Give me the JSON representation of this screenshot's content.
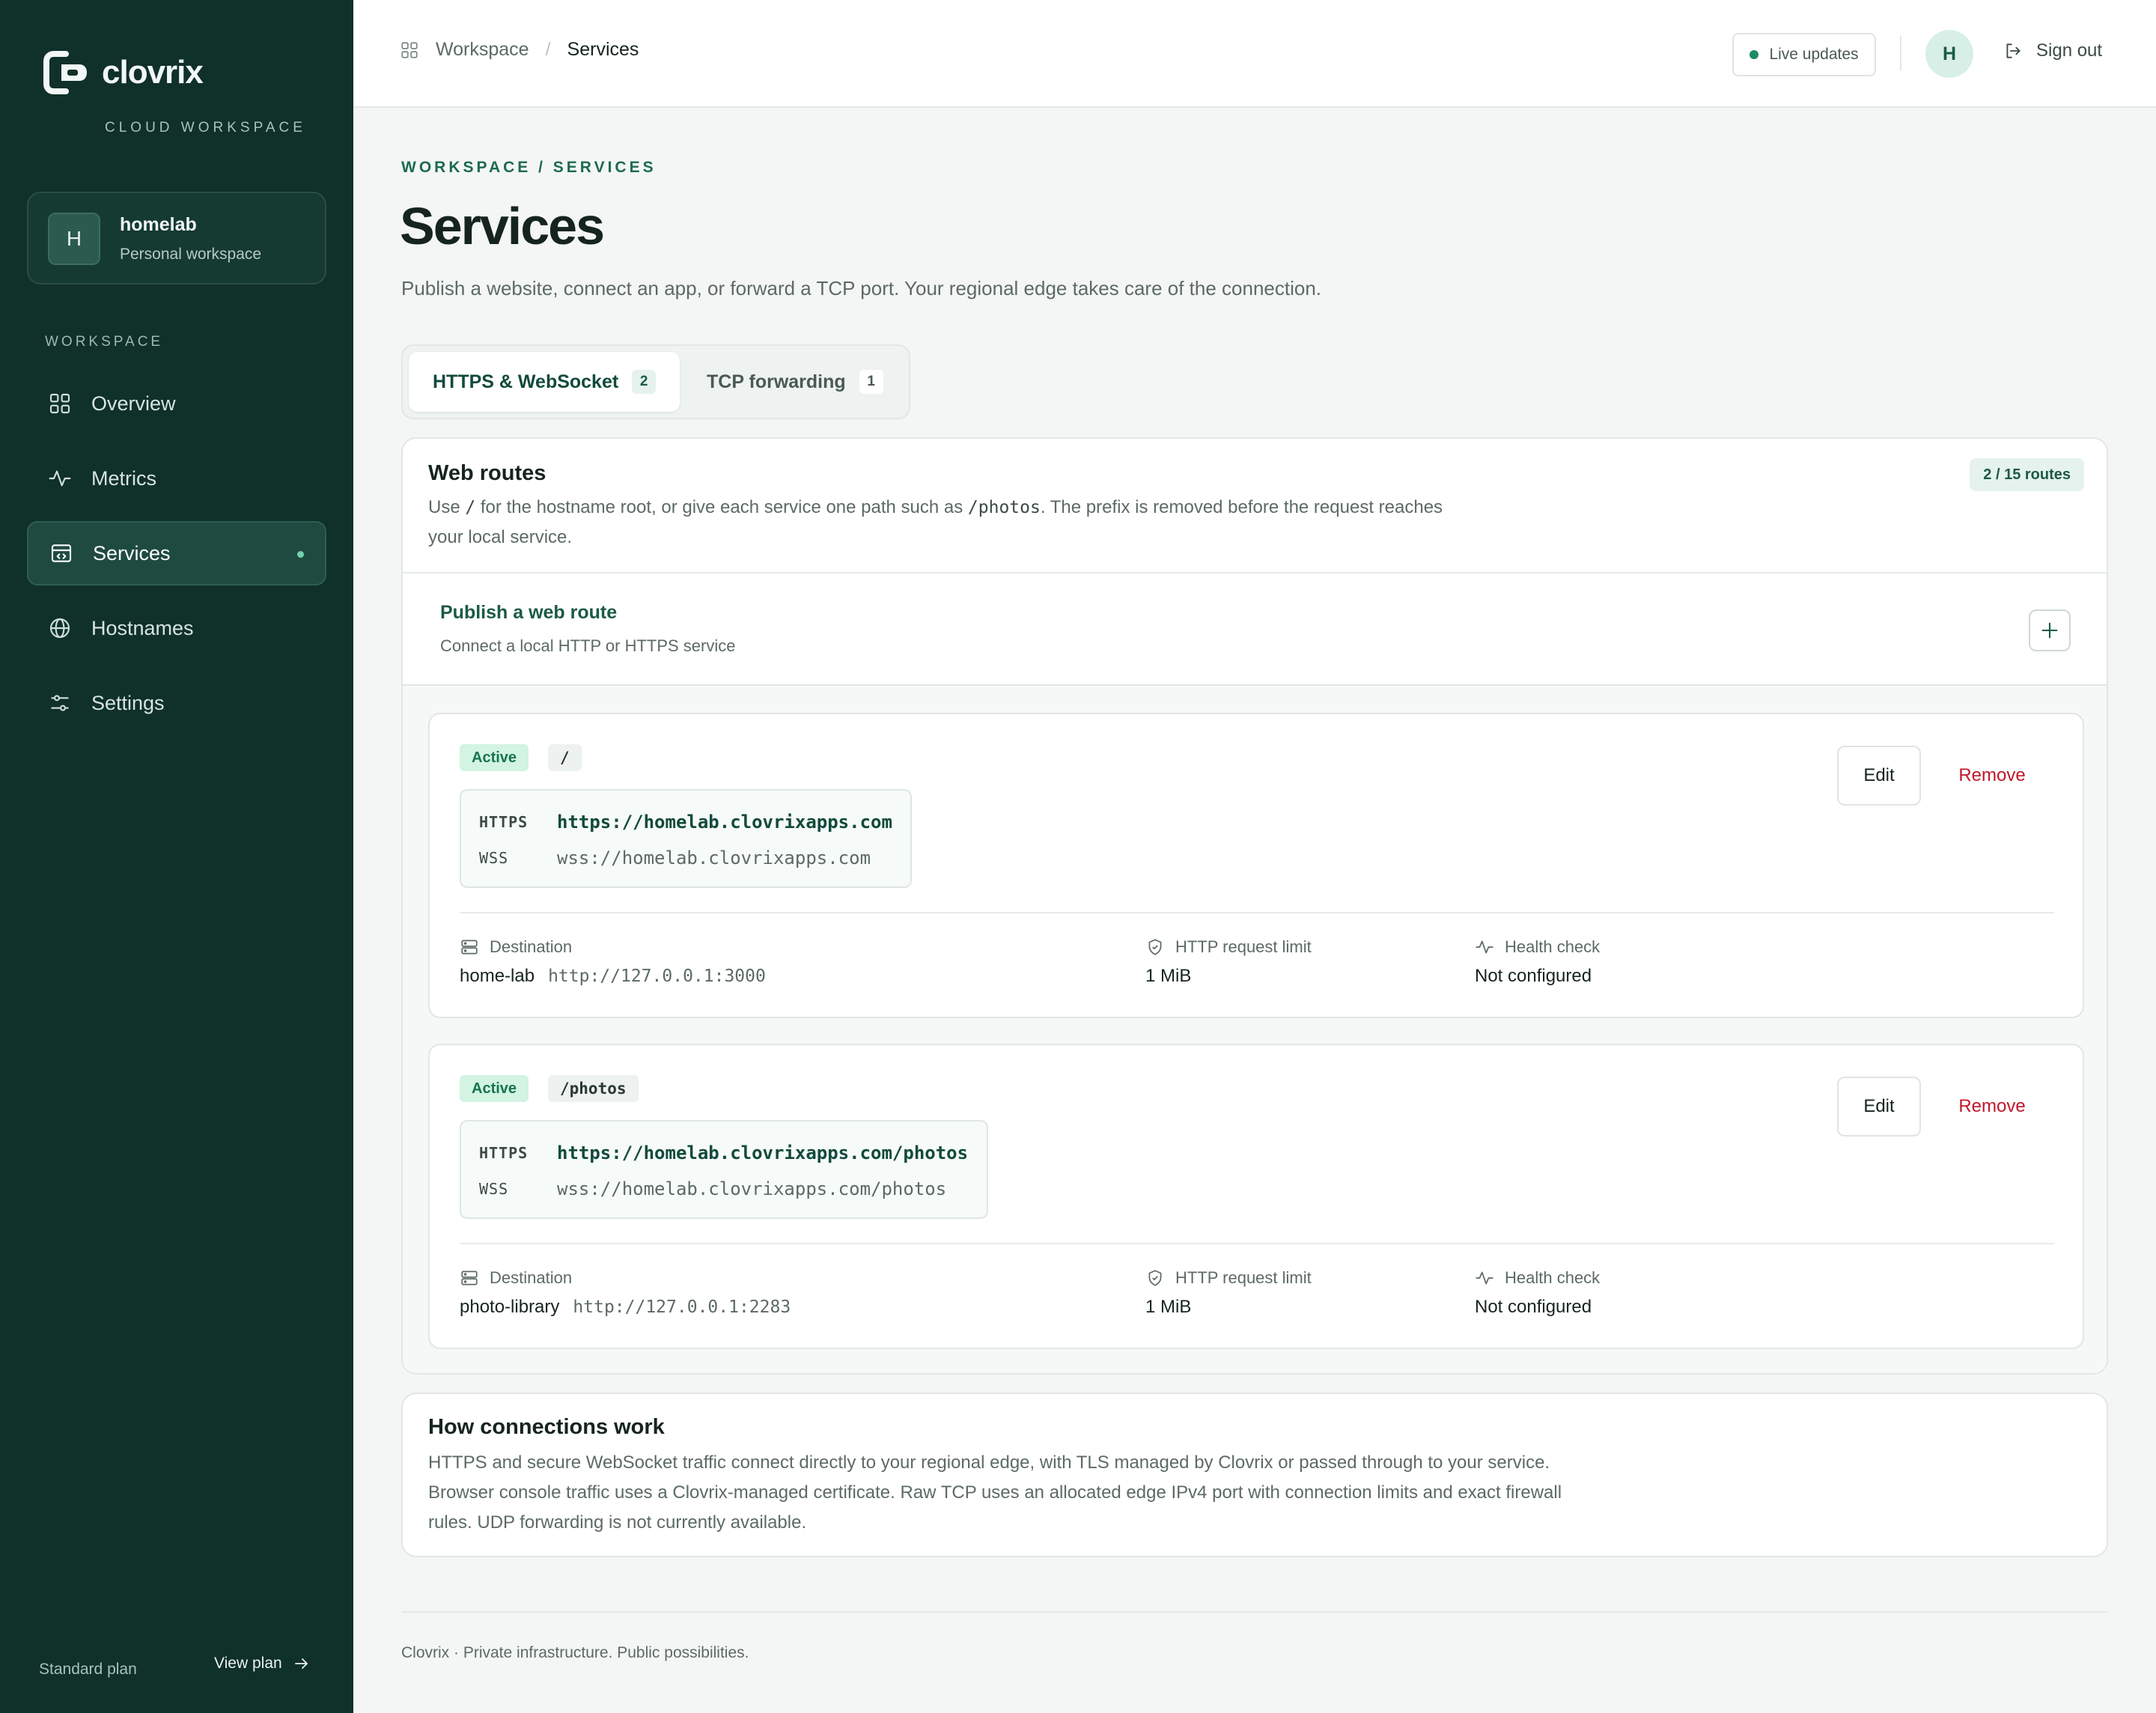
{
  "brand": {
    "name": "clovrix",
    "subtitle": "CLOUD WORKSPACE"
  },
  "workspace_card": {
    "avatar": "H",
    "name": "homelab",
    "type": "Personal workspace"
  },
  "sidebar": {
    "section_label": "WORKSPACE",
    "items": [
      {
        "label": "Overview",
        "icon": "grid-icon"
      },
      {
        "label": "Metrics",
        "icon": "activity-icon"
      },
      {
        "label": "Services",
        "icon": "browser-code-icon",
        "active": true
      },
      {
        "label": "Hostnames",
        "icon": "globe-icon"
      },
      {
        "label": "Settings",
        "icon": "sliders-icon"
      }
    ],
    "plan": {
      "label": "Standard plan",
      "link": "View plan"
    }
  },
  "header": {
    "breadcrumb": [
      "Workspace",
      "Services"
    ],
    "live_updates": "Live updates",
    "avatar": "H",
    "sign_out": "Sign out"
  },
  "page": {
    "eyebrow": "WORKSPACE / SERVICES",
    "title": "Services",
    "description": "Publish a website, connect an app, or forward a TCP port. Your regional edge takes care of the connection."
  },
  "tabs": [
    {
      "label": "HTTPS & WebSocket",
      "count": "2",
      "active": true
    },
    {
      "label": "TCP forwarding",
      "count": "1",
      "active": false
    }
  ],
  "web_routes": {
    "title": "Web routes",
    "badge": "2 / 15 routes",
    "desc_1": "Use ",
    "desc_root": "/",
    "desc_2": " for the hostname root, or give each service one path such as ",
    "desc_path": "/photos",
    "desc_3": ". The prefix is removed before the request reaches your local service.",
    "publish_title": "Publish a web route",
    "publish_sub": "Connect a local HTTP or HTTPS service"
  },
  "routes": [
    {
      "status": "Active",
      "path": "/",
      "https_label": "HTTPS",
      "https_url": "https://homelab.clovrixapps.com",
      "wss_label": "WSS",
      "wss_url": "wss://homelab.clovrixapps.com",
      "edit": "Edit",
      "remove": "Remove",
      "destination_label": "Destination",
      "destination_name": "home-lab",
      "destination_url": "http://127.0.0.1:3000",
      "limit_label": "HTTP request limit",
      "limit_value": "1 MiB",
      "health_label": "Health check",
      "health_value": "Not configured"
    },
    {
      "status": "Active",
      "path": "/photos",
      "https_label": "HTTPS",
      "https_url": "https://homelab.clovrixapps.com/photos",
      "wss_label": "WSS",
      "wss_url": "wss://homelab.clovrixapps.com/photos",
      "edit": "Edit",
      "remove": "Remove",
      "destination_label": "Destination",
      "destination_name": "photo-library",
      "destination_url": "http://127.0.0.1:2283",
      "limit_label": "HTTP request limit",
      "limit_value": "1 MiB",
      "health_label": "Health check",
      "health_value": "Not configured"
    }
  ],
  "how": {
    "title": "How connections work",
    "body": "HTTPS and secure WebSocket traffic connect directly to your regional edge, with TLS managed by Clovrix or passed through to your service. Browser console traffic uses a Clovrix-managed certificate. Raw TCP uses an allocated edge IPv4 port with connection limits and exact firewall rules. UDP forwarding is not currently available."
  },
  "footer": "Clovrix · Private infrastructure. Public possibilities.",
  "colors": {
    "sidebar": "#10302a",
    "accent": "#1b5a47",
    "danger": "#c0182b",
    "success_bg": "#d3f3e3"
  }
}
